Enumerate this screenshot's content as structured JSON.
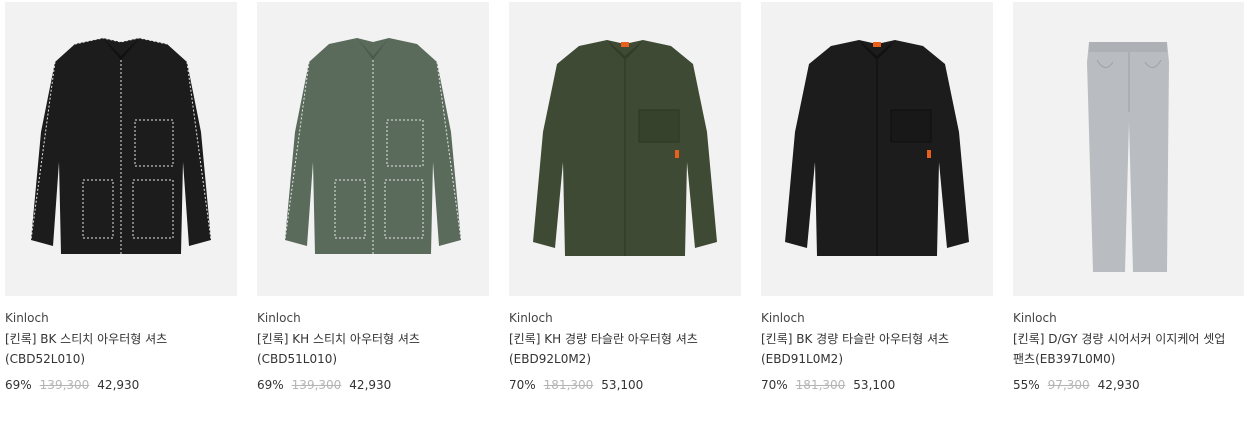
{
  "products": [
    {
      "brand": "Kinloch",
      "name": "[킨록] BK 스티치 아우터형 셔츠 (CBD52L010)",
      "discount": "69%",
      "original_price": "139,300",
      "sale_price": "42,930",
      "image": "black-stitch-overshirt"
    },
    {
      "brand": "Kinloch",
      "name": "[킨록] KH 스티치 아우터형 셔츠 (CBD51L010)",
      "discount": "69%",
      "original_price": "139,300",
      "sale_price": "42,930",
      "image": "khaki-stitch-overshirt"
    },
    {
      "brand": "Kinloch",
      "name": "[킨록] KH 경량 타슬란 아우터형 셔츠(EBD92L0M2)",
      "discount": "70%",
      "original_price": "181,300",
      "sale_price": "53,100",
      "image": "khaki-taslan-overshirt"
    },
    {
      "brand": "Kinloch",
      "name": "[킨록] BK 경량 타슬란 아우터형 셔츠(EBD91L0M2)",
      "discount": "70%",
      "original_price": "181,300",
      "sale_price": "53,100",
      "image": "black-taslan-overshirt"
    },
    {
      "brand": "Kinloch",
      "name": "[킨록] D/GY 경량 시어서커 이지케어 셋업 팬츠(EB397L0M0)",
      "discount": "55%",
      "original_price": "97,300",
      "sale_price": "42,930",
      "image": "gray-seersucker-pants"
    }
  ],
  "colors": {
    "thumb_bg": "#f2f2f2",
    "black_garment": "#1c1c1c",
    "khaki_green": "#5a6b5c",
    "olive": "#3e4a33",
    "gray_pants": "#b9bcc1",
    "orange_accent": "#e8601c",
    "strikethrough": "#b5b5b5"
  }
}
